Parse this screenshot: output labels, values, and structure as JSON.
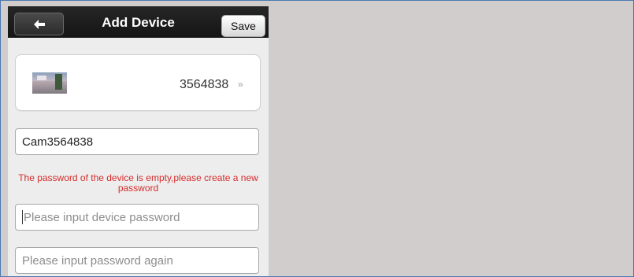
{
  "header": {
    "title": "Add Device",
    "back_icon": "back-arrow-icon",
    "save_label": "Save"
  },
  "device": {
    "id": "3564838",
    "chevron": "»"
  },
  "form": {
    "device_name_value": "Cam3564838",
    "warning": "The password of the device is empty,please create a new password",
    "password_placeholder": "Please input device password",
    "password_again_placeholder": "Please input password again"
  },
  "colors": {
    "warning": "#d62b2b",
    "topbar": "#1c1c1c",
    "background": "#ededed"
  }
}
